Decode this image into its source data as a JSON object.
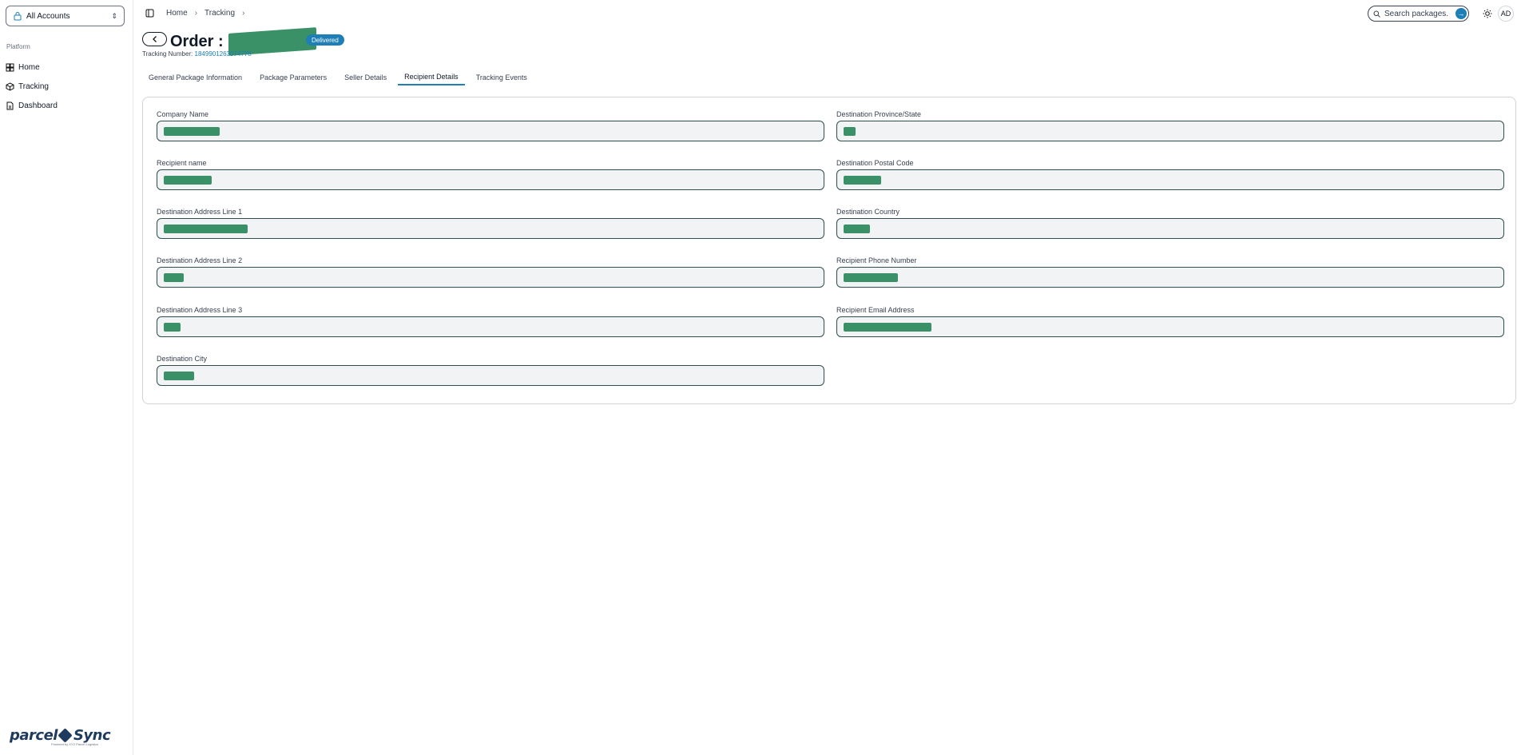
{
  "sidebar": {
    "account_selector": "All Accounts",
    "group_label": "Platform",
    "items": [
      {
        "label": "Home",
        "icon": "home-grid-icon"
      },
      {
        "label": "Tracking",
        "icon": "package-icon"
      },
      {
        "label": "Dashboard",
        "icon": "document-icon"
      }
    ],
    "brand": {
      "name_left": "parcel",
      "name_right": "Sync",
      "tagline": "Powered by XYZ Parcel Logistics"
    }
  },
  "topbar": {
    "breadcrumb": [
      "Home",
      "Tracking"
    ],
    "search_placeholder": "Search packages...",
    "avatar_initials": "AD"
  },
  "header": {
    "order_prefix": "Order :",
    "status": "Delivered",
    "tracking_label": "Tracking Number:",
    "tracking_number": "1849901263074778"
  },
  "tabs": [
    {
      "label": "General Package Information",
      "active": false
    },
    {
      "label": "Package Parameters",
      "active": false
    },
    {
      "label": "Seller Details",
      "active": false
    },
    {
      "label": "Recipient Details",
      "active": true
    },
    {
      "label": "Tracking Events",
      "active": false
    }
  ],
  "form": {
    "left": [
      {
        "label": "Company Name"
      },
      {
        "label": "Recipient name"
      },
      {
        "label": "Destination Address Line 1"
      },
      {
        "label": "Destination Address Line 2"
      },
      {
        "label": "Destination Address Line 3"
      },
      {
        "label": "Destination City"
      }
    ],
    "right": [
      {
        "label": "Destination Province/State"
      },
      {
        "label": "Destination Postal Code"
      },
      {
        "label": "Destination Country"
      },
      {
        "label": "Recipient Phone Number"
      },
      {
        "label": "Recipient Email Address"
      }
    ]
  },
  "colors": {
    "accent": "#1d7fb5",
    "redaction": "#3a9168",
    "input_bg": "#f1f3f5"
  }
}
